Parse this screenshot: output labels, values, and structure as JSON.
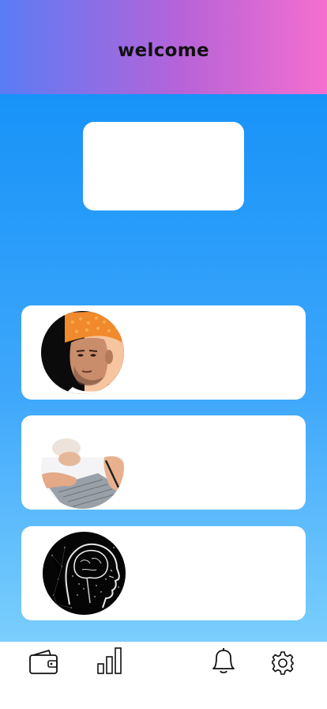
{
  "header": {
    "title": "welcome"
  },
  "cards": [
    {
      "avatar_icon": "person-orange-turban-photo"
    },
    {
      "avatar_icon": "hands-laptop-photo"
    },
    {
      "avatar_icon": "digital-brain-head-photo"
    }
  ],
  "bottom_nav": {
    "items": [
      {
        "icon": "wallet-icon"
      },
      {
        "icon": "bar-chart-icon"
      },
      {
        "icon": "bell-icon"
      },
      {
        "icon": "gear-icon"
      }
    ]
  }
}
